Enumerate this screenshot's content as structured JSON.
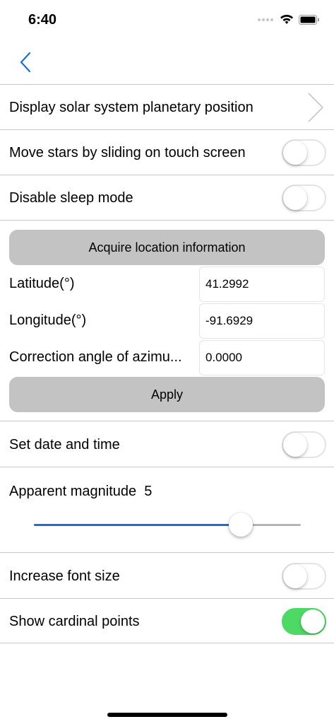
{
  "status_bar": {
    "time": "6:40"
  },
  "settings": {
    "solar_system": "Display solar system planetary position",
    "move_stars": "Move stars by sliding on touch screen",
    "disable_sleep": "Disable sleep mode",
    "acquire_location": "Acquire location information",
    "latitude_label": "Latitude(°)",
    "latitude_value": "41.2992",
    "longitude_label": "Longitude(°)",
    "longitude_value": "-91.6929",
    "azimuth_label": "Correction angle of azimu...",
    "azimuth_value": "0.0000",
    "apply": "Apply",
    "set_date_time": "Set date and time",
    "magnitude_label": "Apparent magnitude",
    "magnitude_value": "5",
    "increase_font": "Increase font size",
    "cardinal_points": "Show cardinal points"
  },
  "toggles": {
    "move_stars": false,
    "disable_sleep": false,
    "set_date_time": false,
    "increase_font": false,
    "cardinal_points": true
  },
  "slider": {
    "fraction": 0.775
  },
  "colors": {
    "accent": "#1a6fd1",
    "switch_on": "#4cd964",
    "button_gray": "#c3c3c3"
  }
}
